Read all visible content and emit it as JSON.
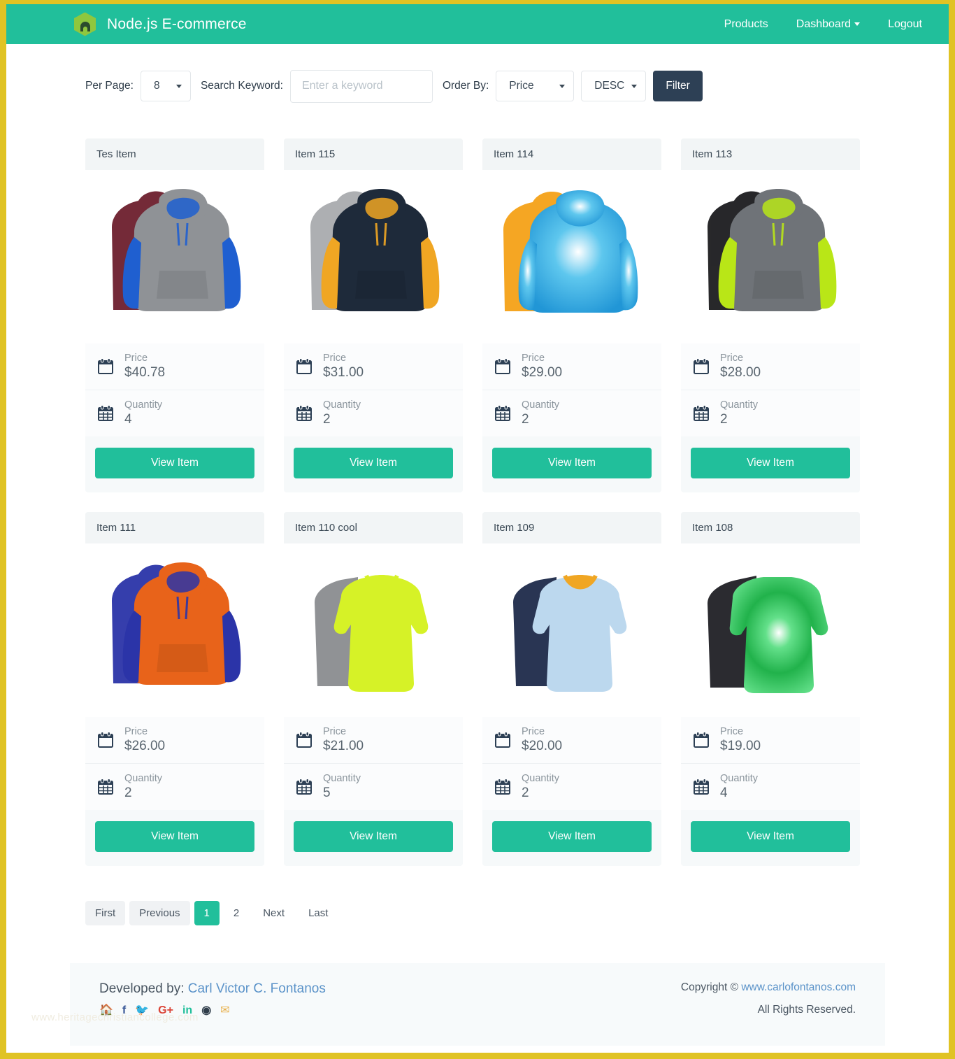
{
  "brand": {
    "title": "Node.js E-commerce",
    "logo_icon": "nodejs-hexagon-icon"
  },
  "nav": {
    "items": [
      {
        "label": "Products",
        "name": "nav-link-products",
        "caret": false
      },
      {
        "label": "Dashboard",
        "name": "nav-link-dashboard",
        "caret": true
      },
      {
        "label": "Logout",
        "name": "nav-link-logout",
        "caret": false
      }
    ]
  },
  "filter_bar": {
    "per_page_label": "Per Page:",
    "per_page_value": "8",
    "search_label": "Search Keyword:",
    "search_placeholder": "Enter a keyword",
    "search_value": "",
    "order_by_label": "Order By:",
    "order_by_value": "Price",
    "order_dir_value": "DESC",
    "filter_button": "Filter"
  },
  "labels": {
    "price": "Price",
    "quantity": "Quantity",
    "view_item": "View Item"
  },
  "products": [
    {
      "title": "Tes Item",
      "price": "$40.78",
      "quantity": "4",
      "image": "hoodie-maroon-blue"
    },
    {
      "title": "Item 115",
      "price": "$31.00",
      "quantity": "2",
      "image": "hoodie-grey-navy"
    },
    {
      "title": "Item 114",
      "price": "$29.00",
      "quantity": "2",
      "image": "hoodie-tiedye-blue"
    },
    {
      "title": "Item 113",
      "price": "$28.00",
      "quantity": "2",
      "image": "hoodie-grey-lime"
    },
    {
      "title": "Item 111",
      "price": "$26.00",
      "quantity": "2",
      "image": "hoodie-orange-blue"
    },
    {
      "title": "Item 110 cool",
      "price": "$21.00",
      "quantity": "5",
      "image": "tee-neon-grey"
    },
    {
      "title": "Item 109",
      "price": "$20.00",
      "quantity": "2",
      "image": "tee-lightblue-navy"
    },
    {
      "title": "Item 108",
      "price": "$19.00",
      "quantity": "4",
      "image": "tee-tiedye-green"
    }
  ],
  "pagination": {
    "first": "First",
    "previous": "Previous",
    "pages": [
      "1",
      "2"
    ],
    "active_page": "1",
    "next": "Next",
    "last": "Last"
  },
  "footer": {
    "developed_by_prefix": "Developed by:",
    "developer_name": "Carl Victor C. Fontanos",
    "social_icons": [
      "home-icon",
      "facebook-icon",
      "twitter-icon",
      "google-plus-icon",
      "linkedin-icon",
      "github-icon",
      "envelope-icon"
    ],
    "copyright_prefix": "Copyright ©",
    "copyright_site": "www.carlofontanos.com",
    "rights": "All Rights Reserved.",
    "watermark": "www.heritagechristiancollege.com"
  },
  "colors": {
    "accent_teal": "#21bf9b",
    "frame_yellow": "#e0c324",
    "filter_navy": "#2d4055",
    "link_blue": "#5b93c9",
    "node_green": "#8fc73e"
  }
}
